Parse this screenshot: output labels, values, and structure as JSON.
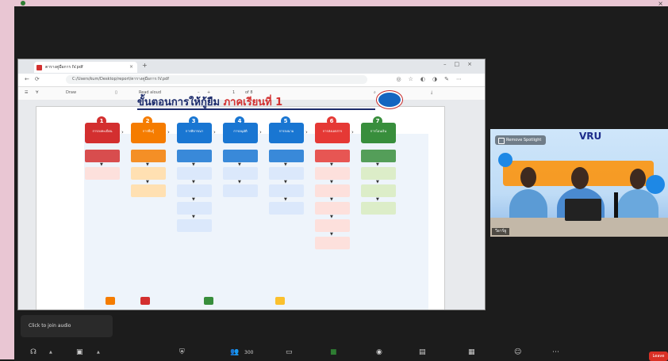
{
  "window": {
    "title_text": "",
    "minimized_label": ""
  },
  "browser": {
    "tab_title": "ตารางคู่มือการ IV.pdf",
    "url": "C:/Users/kum/Desktop/report/ตารางคู่มือการ IV.pdf",
    "toolbar": {
      "draw": "Draw",
      "read_aloud": "Read aloud",
      "page": "1",
      "page_of": "of 8"
    }
  },
  "slide": {
    "title_part1": "ขั้นตอนการให้กู้ยืม",
    "title_part2": "ภาคเรียนที่ 1",
    "steps": [
      {
        "num": "1",
        "label": "การลงทะเบียน",
        "color": "#d32f2f"
      },
      {
        "num": "2",
        "label": "การยื่นกู้",
        "color": "#f57c00"
      },
      {
        "num": "3",
        "label": "การพิจารณา",
        "color": "#1976d2"
      },
      {
        "num": "4",
        "label": "การอนุมัติ",
        "color": "#1976d2"
      },
      {
        "num": "5",
        "label": "การลงนาม",
        "color": "#1976d2"
      },
      {
        "num": "6",
        "label": "การส่งเอกสาร",
        "color": "#e53935"
      },
      {
        "num": "7",
        "label": "การโอนเงิน",
        "color": "#388e3c"
      }
    ]
  },
  "video": {
    "spotlight_label": "Remove Spotlight",
    "logo_text": "VRU",
    "name_badge": "วีอาร์ยู"
  },
  "zoom": {
    "audio_popup": "Click to join audio",
    "participants_count": "300",
    "leave_label": "Leave"
  },
  "colors": {
    "accent": "#2d8cff",
    "leave": "#d93025",
    "pink_border": "#e9c6d3"
  }
}
